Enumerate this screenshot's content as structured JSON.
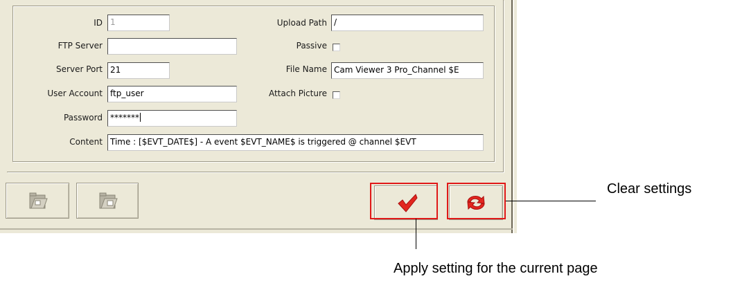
{
  "form": {
    "id_label": "ID",
    "id_value": "1",
    "ftp_server_label": "FTP Server",
    "ftp_server_value": "",
    "server_port_label": "Server Port",
    "server_port_value": "21",
    "user_account_label": "User Account",
    "user_account_value": "ftp_user",
    "password_label": "Password",
    "password_value": "*******",
    "upload_path_label": "Upload Path",
    "upload_path_value": "/",
    "passive_label": "Passive",
    "passive_checked": false,
    "file_name_label": "File Name",
    "file_name_value": "Cam Viewer 3 Pro_Channel $E",
    "attach_picture_label": "Attach Picture",
    "attach_picture_checked": false,
    "content_label": "Content",
    "content_value": "Time : [$EVT_DATE$] - A event $EVT_NAME$ is triggered @ channel $EVT"
  },
  "toolbar": {
    "left_buttons": [
      "folder-open-icon",
      "folder-save-icon"
    ],
    "apply_icon": "checkmark-icon",
    "clear_icon": "refresh-arrows-icon",
    "accent_color": "#e01818"
  },
  "callouts": {
    "clear": "Clear settings",
    "apply": "Apply setting for the current page"
  }
}
